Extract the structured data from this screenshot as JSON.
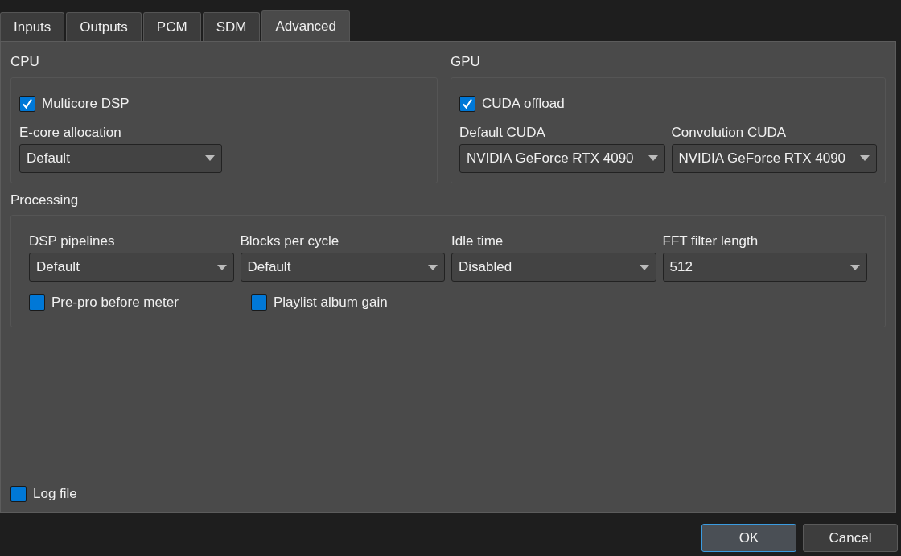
{
  "tabs": [
    {
      "label": "Inputs",
      "selected": false
    },
    {
      "label": "Outputs",
      "selected": false
    },
    {
      "label": "PCM",
      "selected": false
    },
    {
      "label": "SDM",
      "selected": false
    },
    {
      "label": "Advanced",
      "selected": true
    }
  ],
  "cpu": {
    "title": "CPU",
    "checkbox": {
      "label": "Multicore DSP",
      "checked": true
    },
    "dropdowns": [
      {
        "label": "E-core allocation",
        "value": "Default"
      }
    ]
  },
  "gpu": {
    "title": "GPU",
    "checkbox": {
      "label": "CUDA offload",
      "checked": true
    },
    "dropdowns": [
      {
        "label": "Default CUDA",
        "value": "NVIDIA GeForce RTX 4090"
      },
      {
        "label": "Convolution CUDA",
        "value": "NVIDIA GeForce RTX 4090"
      }
    ]
  },
  "processing": {
    "title": "Processing",
    "dropdowns": [
      {
        "label": "DSP pipelines",
        "value": "Default"
      },
      {
        "label": "Blocks per cycle",
        "value": "Default"
      },
      {
        "label": "Idle time",
        "value": "Disabled"
      },
      {
        "label": "FFT filter length",
        "value": "512"
      }
    ],
    "checkboxes": [
      {
        "label": "Pre-pro before meter",
        "checked": false
      },
      {
        "label": "Playlist album gain",
        "checked": false
      }
    ]
  },
  "log_file": {
    "label": "Log file",
    "checked": false
  },
  "buttons": [
    {
      "label": "OK",
      "default": true
    },
    {
      "label": "Cancel",
      "default": false
    }
  ]
}
